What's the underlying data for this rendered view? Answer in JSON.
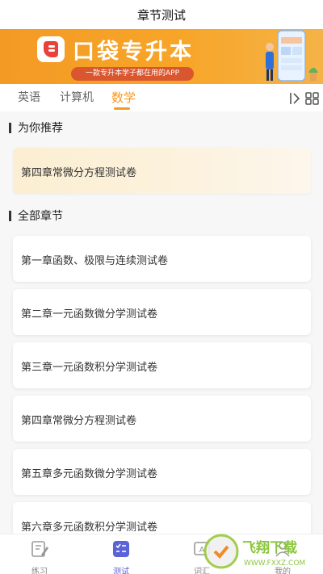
{
  "header": {
    "title": "章节测试"
  },
  "banner": {
    "title": "口袋专升本",
    "subtitle": "一款专升本学子都在用的APP",
    "colors": {
      "bg_start": "#f39a25",
      "bg_end": "#f5b347",
      "pill": "#d9562e"
    }
  },
  "tabs": {
    "items": [
      "英语",
      "计算机",
      "数学"
    ],
    "active": "数学",
    "accent": "#f39a25",
    "icons": [
      "collapse-arrow-icon",
      "grid-icon"
    ]
  },
  "recommend": {
    "title": "为你推荐",
    "items": [
      "第四章常微分方程测试卷"
    ]
  },
  "chapters": {
    "title": "全部章节",
    "items": [
      "第一章函数、极限与连续测试卷",
      "第二章一元函数微分学测试卷",
      "第三章一元函数积分学测试卷",
      "第四章常微分方程测试卷",
      "第五章多元函数微分学测试卷",
      "第六章多元函数积分学测试卷"
    ]
  },
  "bottom_nav": {
    "items": [
      {
        "label": "练习",
        "icon": "edit-icon"
      },
      {
        "label": "测试",
        "icon": "test-list-icon",
        "active": true
      },
      {
        "label": "词汇",
        "icon": "vocabulary-icon"
      },
      {
        "label": "我的",
        "icon": "profile-icon"
      }
    ],
    "active_color": "#5b63d9"
  },
  "watermark": {
    "text": "飞翔下载",
    "site": "WWW.FXXZ.COM"
  }
}
